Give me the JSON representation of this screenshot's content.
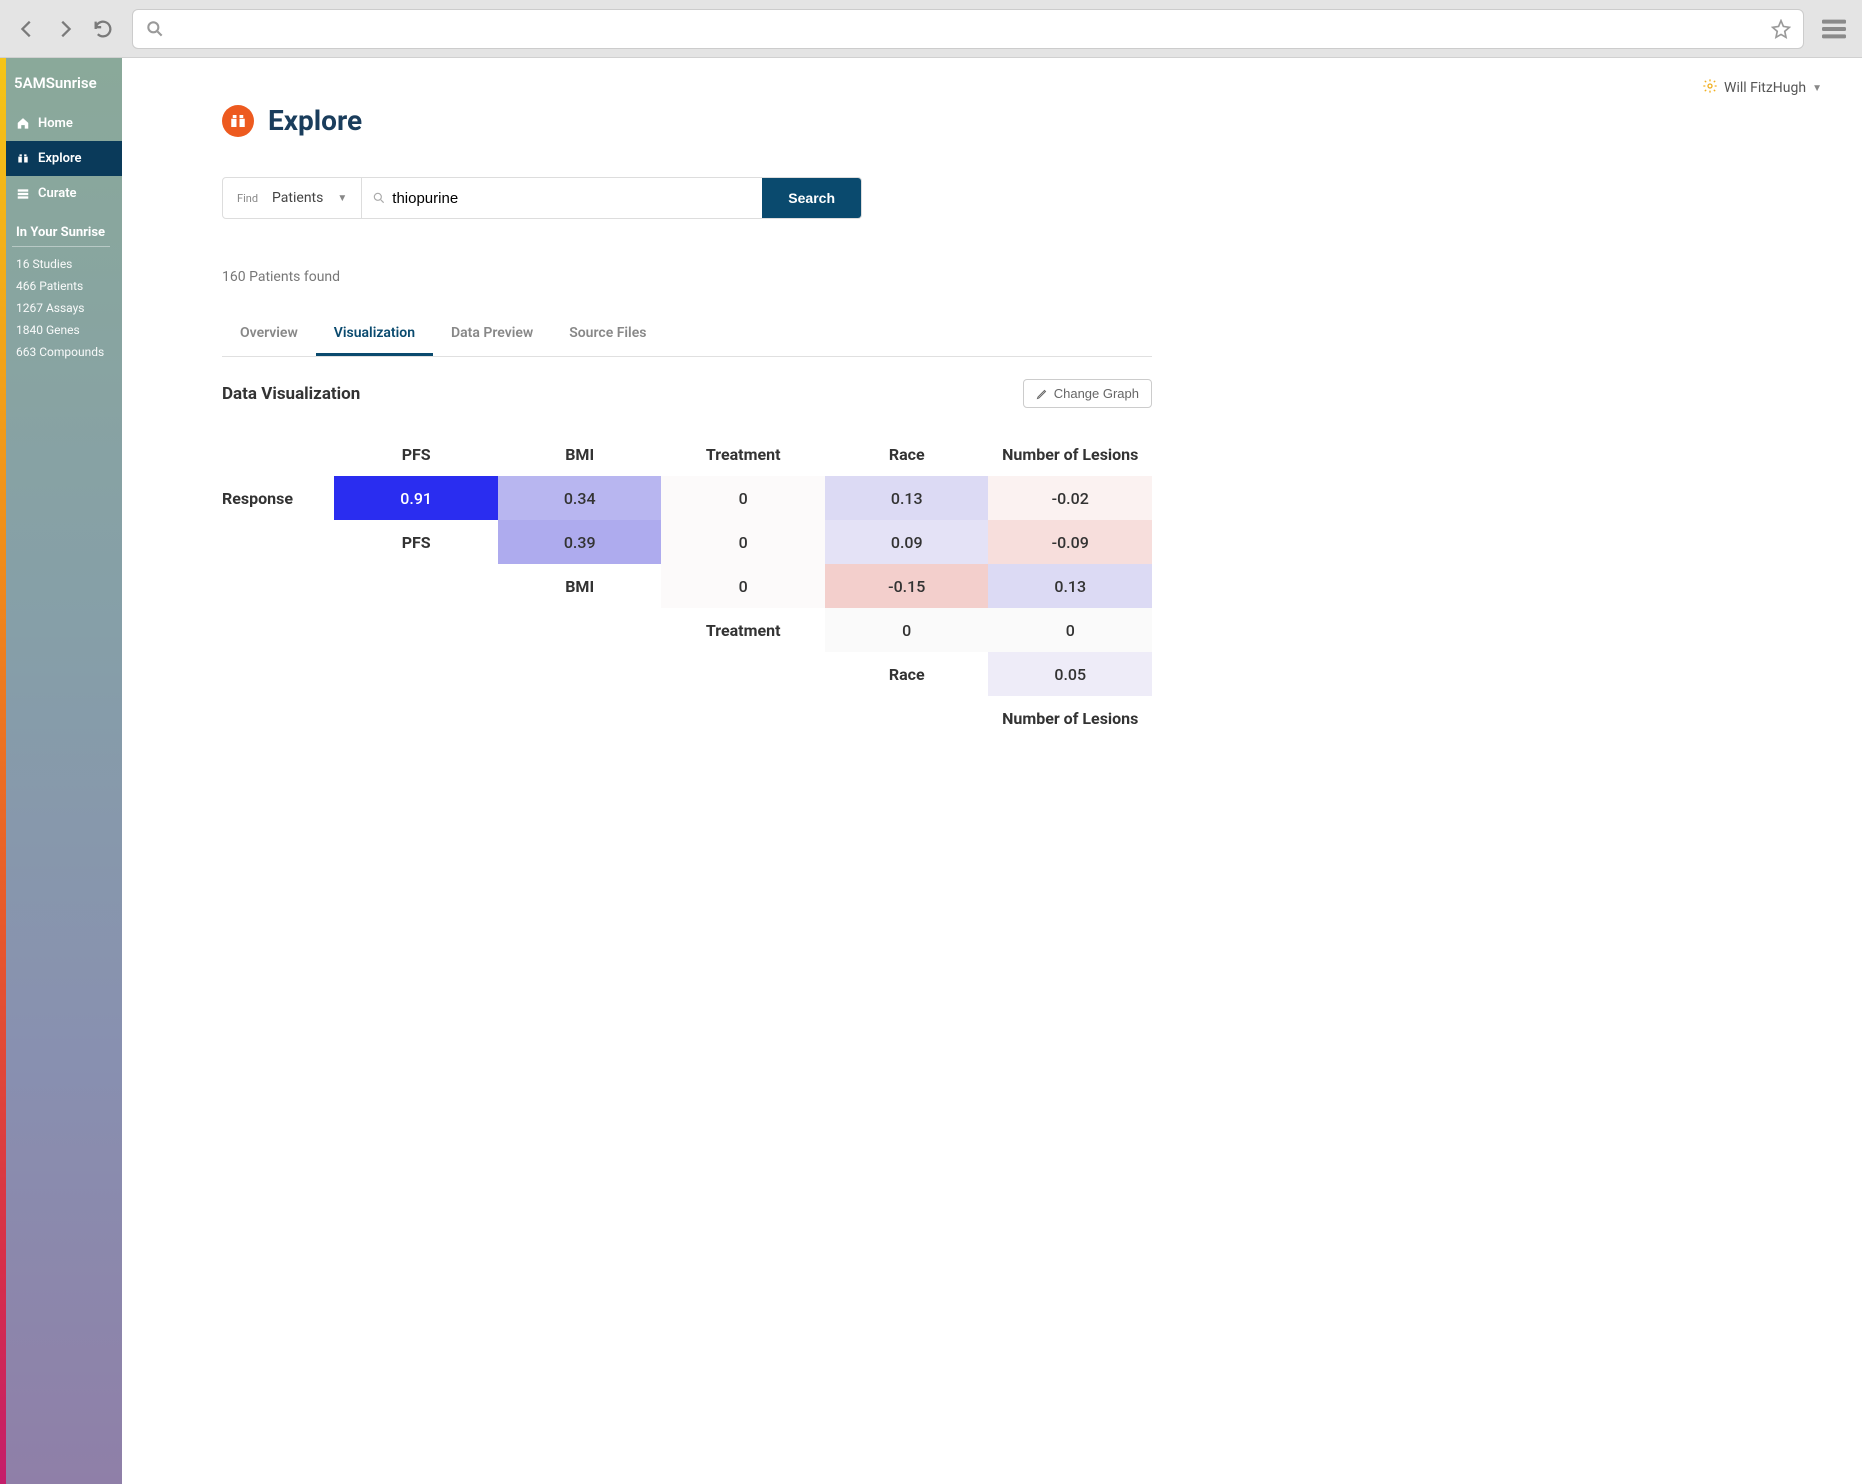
{
  "brand": "5AMSunrise",
  "user": {
    "name": "Will FitzHugh"
  },
  "sidebar": {
    "items": [
      {
        "label": "Home"
      },
      {
        "label": "Explore"
      },
      {
        "label": "Curate"
      }
    ],
    "section_header": "In Your Sunrise",
    "stats": [
      "16 Studies",
      "466 Patients",
      "1267 Assays",
      "1840 Genes",
      "663 Compounds"
    ]
  },
  "page": {
    "title": "Explore",
    "find_label": "Find",
    "entity": "Patients",
    "query": "thiopurine",
    "search_label": "Search",
    "results_text": "160 Patients found"
  },
  "tabs": [
    {
      "label": "Overview",
      "active": false
    },
    {
      "label": "Visualization",
      "active": true
    },
    {
      "label": "Data Preview",
      "active": false
    },
    {
      "label": "Source Files",
      "active": false
    }
  ],
  "viz": {
    "heading": "Data Visualization",
    "change_graph_label": "Change Graph"
  },
  "chart_data": {
    "type": "heatmap",
    "columns": [
      "PFS",
      "BMI",
      "Treatment",
      "Race",
      "Number of Lesions"
    ],
    "rows": [
      "Response",
      "PFS",
      "BMI",
      "Treatment",
      "Race",
      "Number of Lesions"
    ],
    "cells": [
      {
        "r": 0,
        "c": 0,
        "v": 0.91,
        "bg": "#2a2df0",
        "fg": "#ffffff"
      },
      {
        "r": 0,
        "c": 1,
        "v": 0.34,
        "bg": "#b8b6f0",
        "fg": "#333"
      },
      {
        "r": 0,
        "c": 2,
        "v": 0,
        "bg": "#fcfafa",
        "fg": "#333"
      },
      {
        "r": 0,
        "c": 3,
        "v": 0.13,
        "bg": "#dcdaf4",
        "fg": "#333"
      },
      {
        "r": 0,
        "c": 4,
        "v": -0.02,
        "bg": "#fbf2f1",
        "fg": "#333"
      },
      {
        "r": 1,
        "c": 1,
        "v": 0.39,
        "bg": "#aeabee",
        "fg": "#333"
      },
      {
        "r": 1,
        "c": 2,
        "v": 0,
        "bg": "#fcfafa",
        "fg": "#333"
      },
      {
        "r": 1,
        "c": 3,
        "v": 0.09,
        "bg": "#e4e2f6",
        "fg": "#333"
      },
      {
        "r": 1,
        "c": 4,
        "v": -0.09,
        "bg": "#f7dedc",
        "fg": "#333"
      },
      {
        "r": 2,
        "c": 2,
        "v": 0,
        "bg": "#fcfafa",
        "fg": "#333"
      },
      {
        "r": 2,
        "c": 3,
        "v": -0.15,
        "bg": "#f3cfcc",
        "fg": "#333"
      },
      {
        "r": 2,
        "c": 4,
        "v": 0.13,
        "bg": "#dcdaf4",
        "fg": "#333"
      },
      {
        "r": 3,
        "c": 3,
        "v": 0,
        "bg": "#fafafa",
        "fg": "#333"
      },
      {
        "r": 3,
        "c": 4,
        "v": 0,
        "bg": "#fafafa",
        "fg": "#333"
      },
      {
        "r": 4,
        "c": 4,
        "v": 0.05,
        "bg": "#eeecf8",
        "fg": "#333"
      }
    ]
  }
}
